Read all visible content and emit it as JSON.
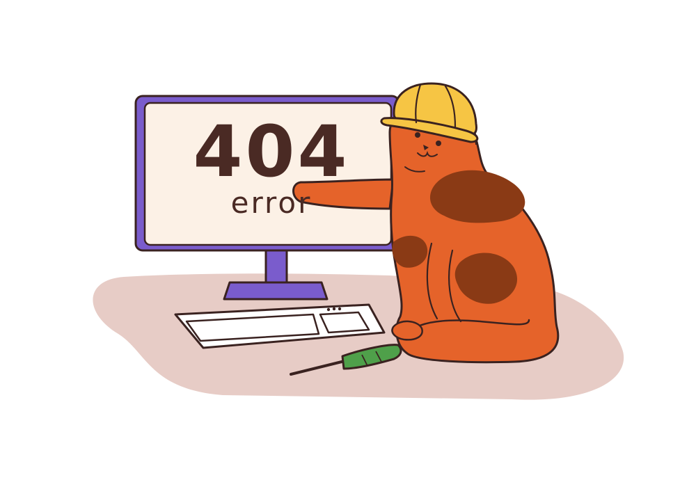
{
  "error": {
    "code": "404",
    "word": "error"
  },
  "colors": {
    "floor": "#e7ccc6",
    "monitor_frame": "#7a5ccc",
    "screen": "#fcf1e6",
    "text": "#4a2a24",
    "cat": "#e5632a",
    "cat_spots": "#8a3a15",
    "helmet": "#f6c544",
    "screwdriver_handle": "#4fa04a",
    "outline": "#3a2220"
  },
  "icons": [
    "floor-shape",
    "monitor",
    "keyboard",
    "screwdriver",
    "cat",
    "hard-hat"
  ]
}
